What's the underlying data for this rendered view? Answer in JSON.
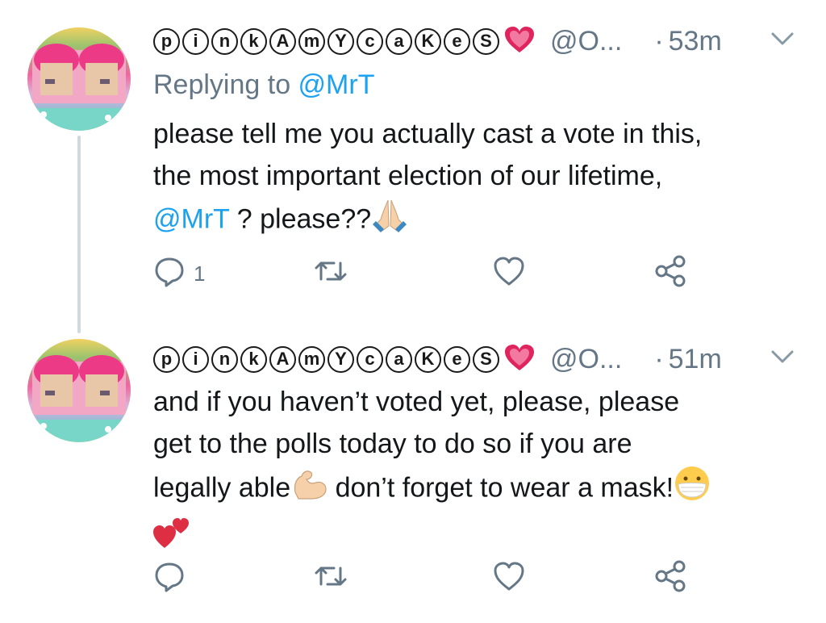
{
  "tweets": [
    {
      "display_name_letters": [
        "p",
        "i",
        "n",
        "k",
        "A",
        "m",
        "Y",
        "c",
        "a",
        "K",
        "e",
        "S"
      ],
      "display_name_emoji": "heart-icon",
      "handle": "@O...",
      "separator": "·",
      "time": "53m",
      "replying_prefix": "Replying to ",
      "replying_mention": "@MrT",
      "text_line1": "please tell me you actually cast a vote in this,",
      "text_line2": "the most important election of our lifetime,",
      "text_mention": "@MrT",
      "text_line3_rest": " ? please??",
      "reply_count": "1"
    },
    {
      "display_name_letters": [
        "p",
        "i",
        "n",
        "k",
        "A",
        "m",
        "Y",
        "c",
        "a",
        "K",
        "e",
        "S"
      ],
      "display_name_emoji": "heart-icon",
      "handle": "@O...",
      "separator": "·",
      "time": "51m",
      "text_line1": "and if you haven’t voted yet, please, please",
      "text_line2": "get to the polls today to do so if you are",
      "text_line3a": "legally able",
      "text_line3b": " don’t forget to wear a mask!",
      "reply_count": ""
    }
  ],
  "colors": {
    "accent": "#1da1f2",
    "secondary_text": "#657786",
    "body_text": "#14171a",
    "thread_line": "#cfd9de",
    "heart": "#e0245e"
  }
}
